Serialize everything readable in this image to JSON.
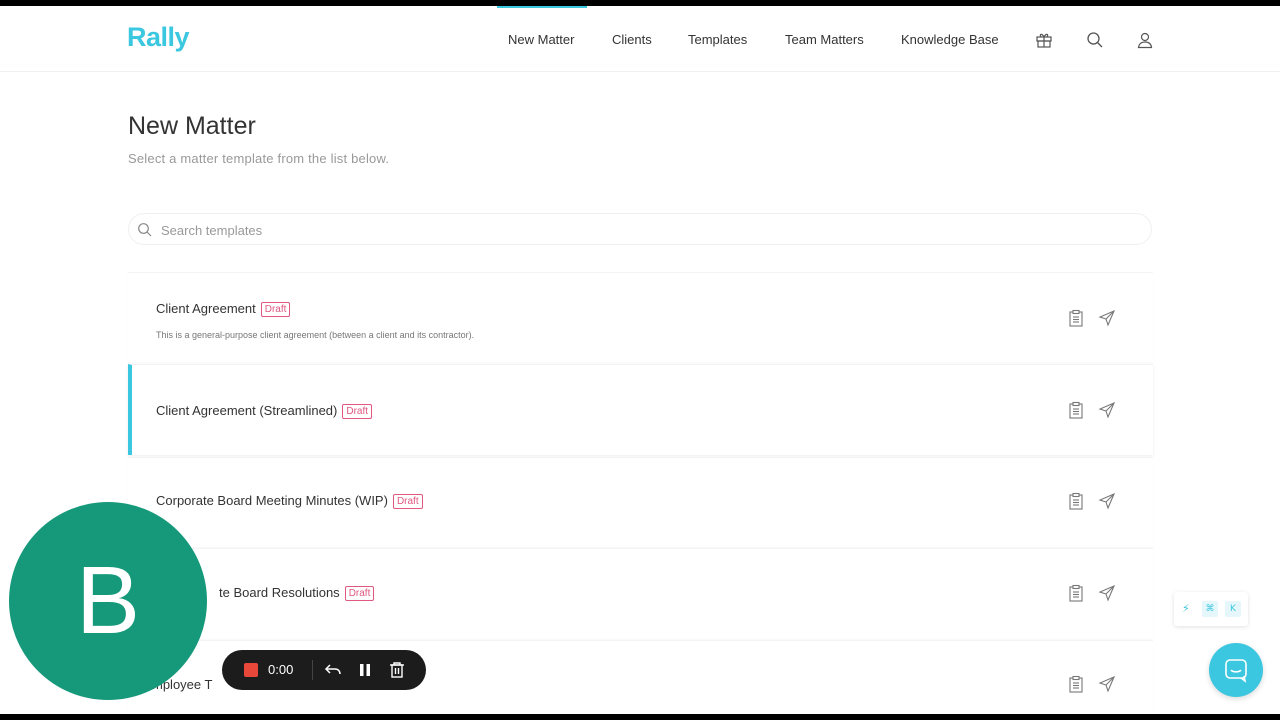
{
  "app": {
    "logo": "Rally"
  },
  "nav": {
    "items": [
      {
        "label": "New Matter",
        "active": true
      },
      {
        "label": "Clients"
      },
      {
        "label": "Templates"
      },
      {
        "label": "Team Matters"
      },
      {
        "label": "Knowledge Base"
      }
    ],
    "icons": [
      "gift-icon",
      "search-icon",
      "user-icon"
    ]
  },
  "page": {
    "title": "New Matter",
    "subtitle": "Select a matter template from the list below."
  },
  "search": {
    "placeholder": "Search templates"
  },
  "templates": [
    {
      "name": "Client Agreement",
      "badge": "Draft",
      "description": "This is a general-purpose client agreement (between a client and its contractor)."
    },
    {
      "name": "Client Agreement (Streamlined)",
      "badge": "Draft",
      "selected": true
    },
    {
      "name": "Corporate Board Meeting Minutes (WIP)",
      "badge": "Draft"
    },
    {
      "name": "te Board Resolutions",
      "badge": "Draft"
    },
    {
      "name": "mployee T"
    }
  ],
  "recorder": {
    "avatar_letter": "B",
    "time": "0:00",
    "buttons": [
      "stop-icon",
      "undo-icon",
      "pause-icon",
      "trash-icon"
    ]
  },
  "command_hint": {
    "bolt": "⚡",
    "key1": "⌘",
    "key2": "K"
  },
  "colors": {
    "accent": "#3cc7e0",
    "draft_badge": "#e05780",
    "avatar": "#16997a",
    "recorder_stop": "#e8483a"
  }
}
